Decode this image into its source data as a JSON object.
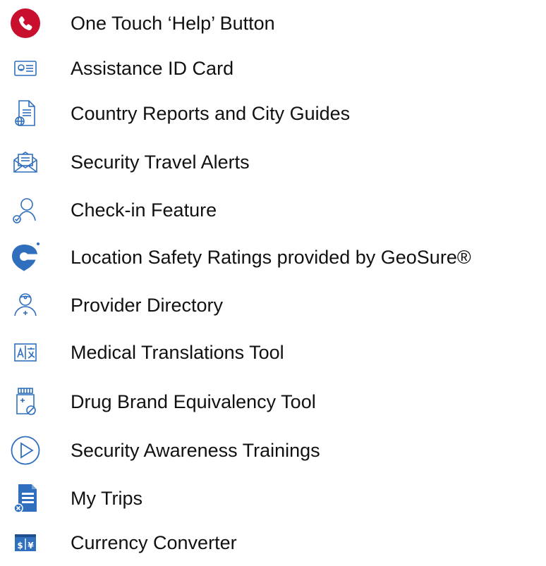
{
  "colors": {
    "icon_blue": "#2f6fbe",
    "help_red": "#c8102e",
    "text": "#111111"
  },
  "features": [
    {
      "icon": "phone-icon",
      "label": "One Touch ‘Help’ Button"
    },
    {
      "icon": "id-card-icon",
      "label": "Assistance ID Card"
    },
    {
      "icon": "globe-document-icon",
      "label": "Country Reports and City Guides"
    },
    {
      "icon": "envelope-icon",
      "label": "Security Travel Alerts"
    },
    {
      "icon": "person-check-icon",
      "label": "Check-in Feature"
    },
    {
      "icon": "geosure-logo-icon",
      "label": "Location Safety Ratings provided by GeoSure®"
    },
    {
      "icon": "doctor-icon",
      "label": "Provider Directory"
    },
    {
      "icon": "translate-icon",
      "label": "Medical Translations Tool"
    },
    {
      "icon": "pill-bottle-icon",
      "label": "Drug Brand Equivalency Tool"
    },
    {
      "icon": "play-circle-icon",
      "label": "Security Awareness Trainings"
    },
    {
      "icon": "trip-document-icon",
      "label": "My Trips"
    },
    {
      "icon": "currency-icon",
      "label": "Currency Converter"
    }
  ]
}
